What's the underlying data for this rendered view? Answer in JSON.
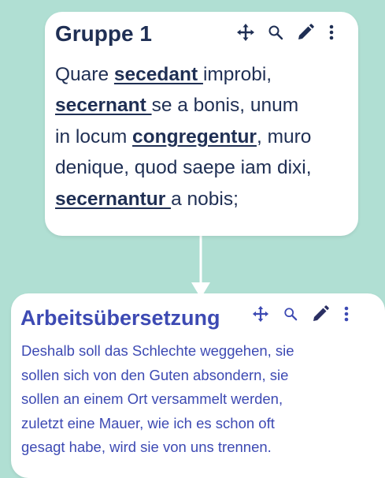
{
  "group_card": {
    "title": "Gruppe 1",
    "text": {
      "t1": "Quare ",
      "v1": "secedant ",
      "t2": "improbi,",
      "v2": "secernant ",
      "t3": "se a bonis, unum",
      "t4": "in locum ",
      "v3": "congregentur",
      "t5": ", muro",
      "t6": "denique, quod saepe iam dixi,",
      "v4": "secernantur ",
      "t7": "a nobis;"
    },
    "toolbar": {
      "move_icon": "move-icon",
      "search_icon": "search-icon",
      "edit_icon": "edit-icon",
      "menu_icon": "more-vertical-icon"
    }
  },
  "translation_card": {
    "title": "Arbeitsübersetzung",
    "lines": [
      "Deshalb soll das Schlechte weggehen, sie",
      "sollen sich von den Guten absondern, sie",
      "sollen an einem Ort versammelt werden,",
      "zuletzt eine Mauer, wie ich es schon oft",
      "gesagt habe, wird sie von uns trennen."
    ],
    "toolbar": {
      "move_icon": "move-icon",
      "search_icon": "search-icon",
      "edit_icon": "edit-icon",
      "menu_icon": "more-vertical-icon"
    }
  },
  "colors": {
    "background": "#b0dfd3",
    "card": "#ffffff",
    "latin_text": "#1f2f54",
    "translation_text": "#3d4ab3"
  }
}
